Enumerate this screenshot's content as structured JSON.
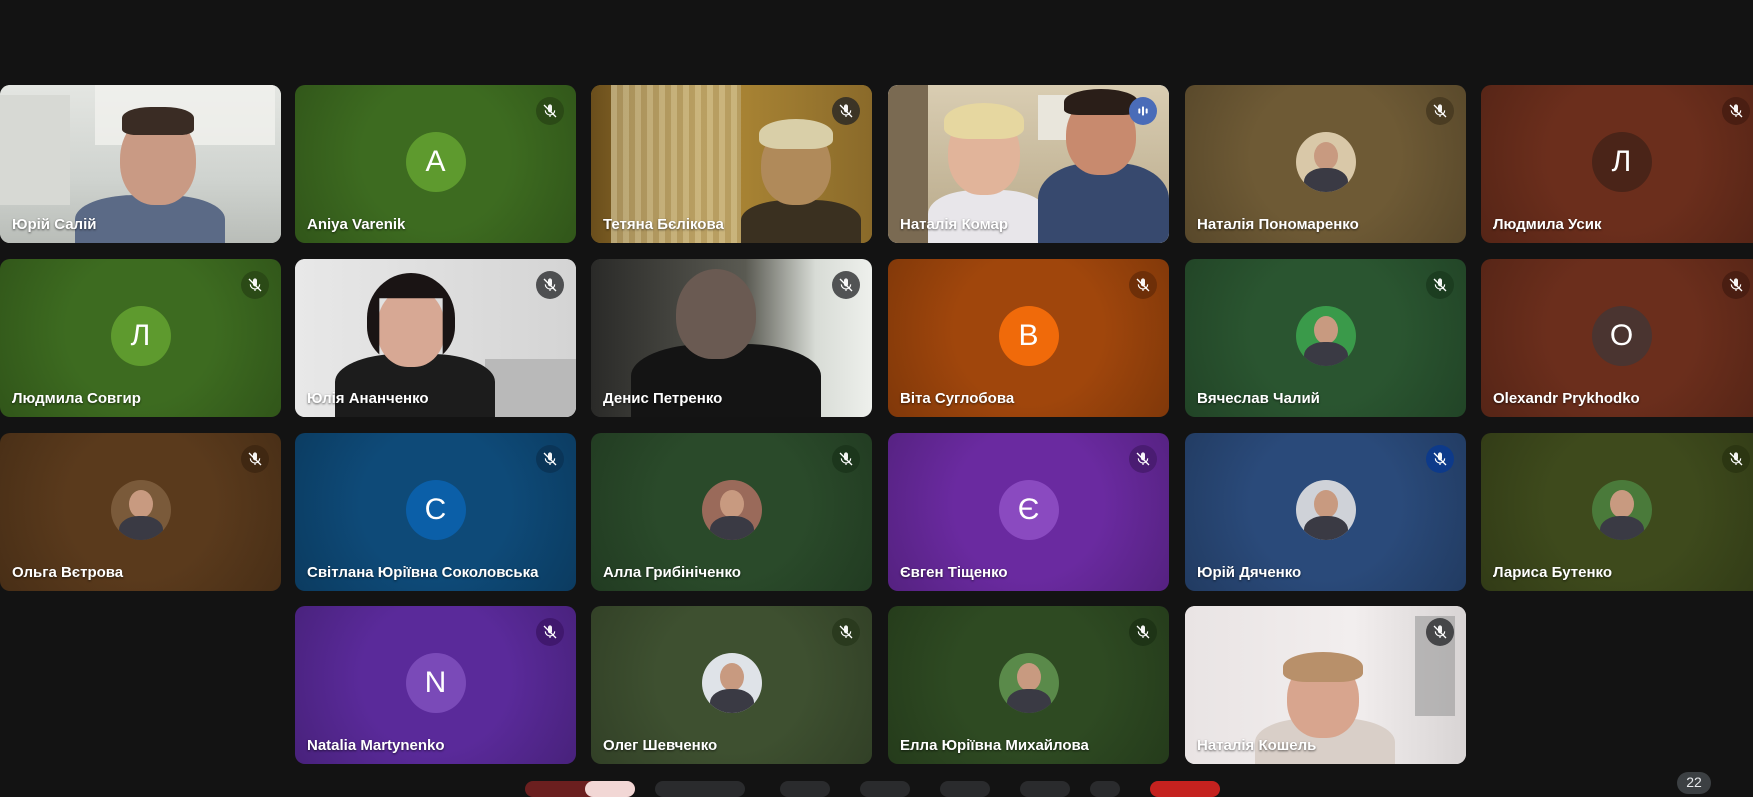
{
  "participants": [
    {
      "name": "Юрій Салій",
      "type": "video",
      "muted": false,
      "bg": "#cfd2cc",
      "scene": "office-man"
    },
    {
      "name": "Aniya Varenik",
      "type": "letter",
      "letter": "A",
      "muted": true,
      "bg": "#3d6b20",
      "avatar_bg": "#5e9a2e",
      "mute_bg": "#2b4a16"
    },
    {
      "name": "Тетяна Бєлікова",
      "type": "video",
      "muted": true,
      "bg": "#9a7a2a",
      "scene": "woman-dim"
    },
    {
      "name": "Наталія Комар",
      "type": "video",
      "muted": false,
      "speaking": true,
      "bg": "#c9b99a",
      "scene": "couple"
    },
    {
      "name": "Наталія Пономаренко",
      "type": "photo",
      "muted": true,
      "bg": "#6e5a35",
      "mute_bg": "#4a3c22",
      "photo_bg": "#d9c8a8"
    },
    {
      "name": "Людмила Усик",
      "type": "letter",
      "letter": "Л",
      "muted": true,
      "bg": "#6b2e1c",
      "avatar_bg": "#4a2418",
      "mute_bg": "#4a1e12"
    },
    {
      "name": "Людмила Совгир",
      "type": "letter",
      "letter": "Л",
      "muted": true,
      "bg": "#3d6b20",
      "avatar_bg": "#5e9a2e",
      "mute_bg": "#2b4a16"
    },
    {
      "name": "Юлія Ананченко",
      "type": "video",
      "muted": true,
      "bg": "#dcdcdc",
      "scene": "woman-headset"
    },
    {
      "name": "Денис Петренко",
      "type": "video",
      "muted": true,
      "bg": "#3a3a36",
      "scene": "man-dark"
    },
    {
      "name": "Віта Суглобова",
      "type": "letter",
      "letter": "В",
      "muted": true,
      "bg": "#a0460c",
      "avatar_bg": "#f06a0a",
      "mute_bg": "#6e2f08"
    },
    {
      "name": "Вячеслав Чалий",
      "type": "photo",
      "muted": true,
      "bg": "#2a5530",
      "mute_bg": "#1c3d20",
      "photo_bg": "#3a9a4a"
    },
    {
      "name": "Olexandr Prykhodko",
      "type": "letter",
      "letter": "O",
      "muted": true,
      "bg": "#6b2e1c",
      "avatar_bg": "#4a3430",
      "mute_bg": "#4a1e12"
    },
    {
      "name": "Ольга Вєтрова",
      "type": "photo",
      "muted": true,
      "bg": "#5a3a1c",
      "mute_bg": "#402812",
      "photo_bg": "#7a5a3a"
    },
    {
      "name": "Світлана Юріївна Соколовська",
      "type": "letter",
      "letter": "С",
      "muted": true,
      "bg": "#0e4a78",
      "avatar_bg": "#0b5fa8",
      "mute_bg": "#0a3558"
    },
    {
      "name": "Алла Грибініченко",
      "type": "photo",
      "muted": true,
      "bg": "#2a4a2a",
      "mute_bg": "#1c361c",
      "photo_bg": "#9a6a5a"
    },
    {
      "name": "Євген Тіщенко",
      "type": "letter",
      "letter": "Є",
      "muted": true,
      "bg": "#6a2aa0",
      "avatar_bg": "#8a4ac0",
      "mute_bg": "#4a1c72"
    },
    {
      "name": "Юрій Дяченко",
      "type": "photo",
      "muted": true,
      "bg": "#2a4a7a",
      "mute_bg": "#0d3a8a",
      "photo_bg": "#cfd2d8"
    },
    {
      "name": "Лариса Бутенко",
      "type": "photo",
      "muted": true,
      "bg": "#3e4a1c",
      "mute_bg": "#2c3612",
      "photo_bg": "#4a7a3a"
    },
    {
      "name": "Natalia Martynenko",
      "type": "letter",
      "letter": "N",
      "muted": true,
      "bg": "#5a2a9a",
      "avatar_bg": "#7a4ab8",
      "mute_bg": "#40186e"
    },
    {
      "name": "Олег Шевченко",
      "type": "photo",
      "muted": true,
      "bg": "#3e5030",
      "mute_bg": "#2a3a1e",
      "photo_bg": "#dfe3e8"
    },
    {
      "name": "Елла Юріївна Михайлова",
      "type": "photo",
      "muted": true,
      "bg": "#2e4a22",
      "mute_bg": "#1e3416",
      "photo_bg": "#5a8a4a"
    },
    {
      "name": "Наталія Кошель",
      "type": "video",
      "muted": true,
      "bg": "#e8e4e4",
      "scene": "woman-light"
    }
  ],
  "participant_count": "22",
  "colors": {
    "background": "#131313",
    "speaking_outline": "#a8c7fa"
  }
}
